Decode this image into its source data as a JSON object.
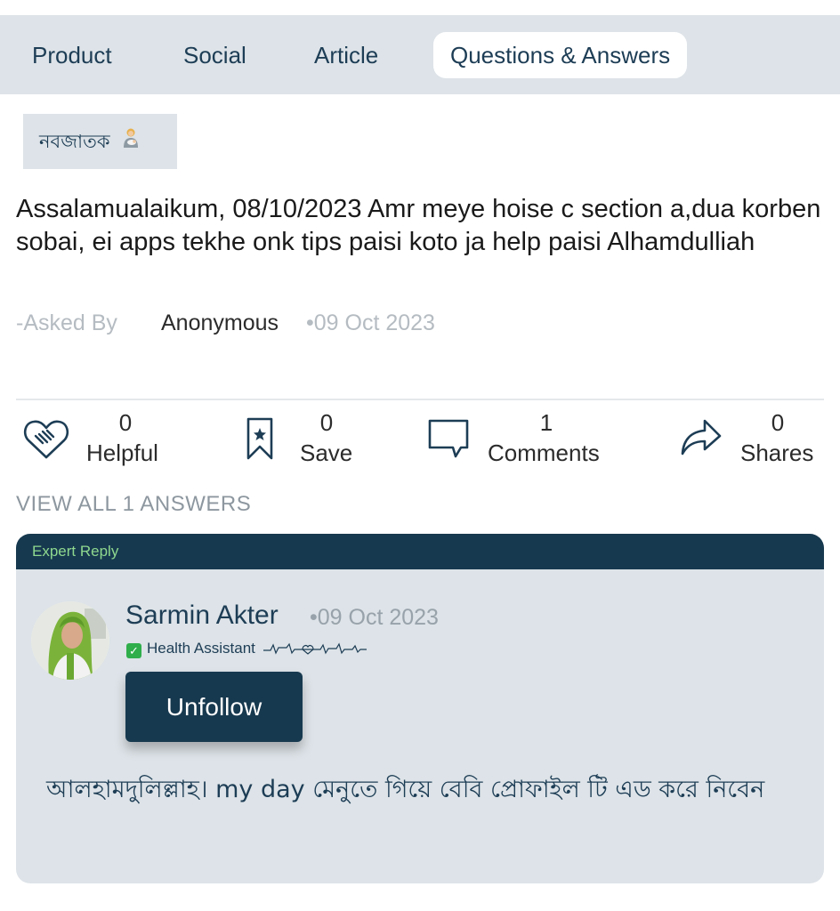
{
  "tabs": [
    {
      "label": "Product",
      "active": false
    },
    {
      "label": "Social",
      "active": false
    },
    {
      "label": "Article",
      "active": false
    },
    {
      "label": "Questions & Answers",
      "active": true
    }
  ],
  "post": {
    "tag": "নবজাতক",
    "tag_icon": "person-feeding-baby-icon",
    "question": "Assalamualaikum, 08/10/2023 Amr meye hoise c section a,dua korben sobai, ei apps tekhe onk tips paisi koto ja help paisi Alhamdulliah",
    "asked_by_label": "-Asked By",
    "author": "Anonymous",
    "date": "•09 Oct 2023"
  },
  "actions": {
    "helpful": {
      "count": "0",
      "label": "Helpful",
      "icon": "heart-handshake-icon"
    },
    "save": {
      "count": "0",
      "label": "Save",
      "icon": "bookmark-star-icon"
    },
    "comments": {
      "count": "1",
      "label": "Comments",
      "icon": "speech-bubble-icon"
    },
    "shares": {
      "count": "0",
      "label": "Shares",
      "icon": "share-arrow-icon"
    }
  },
  "view_all": "VIEW ALL 1 ANSWERS",
  "reply": {
    "badge": "Expert Reply",
    "author": "Sarmin Akter",
    "date": "•09 Oct 2023",
    "role": "Health Assistant",
    "role_icon": "check-icon",
    "unfollow_label": "Unfollow",
    "text": "আলহামদুলিল্লাহ। my day মেনুতে গিয়ে বেবি প্রোফাইল টি এড করে নিবেন"
  },
  "colors": {
    "primary_dark": "#17394f",
    "tab_bg": "#dde3e8",
    "expert_green": "#8ed88f"
  }
}
